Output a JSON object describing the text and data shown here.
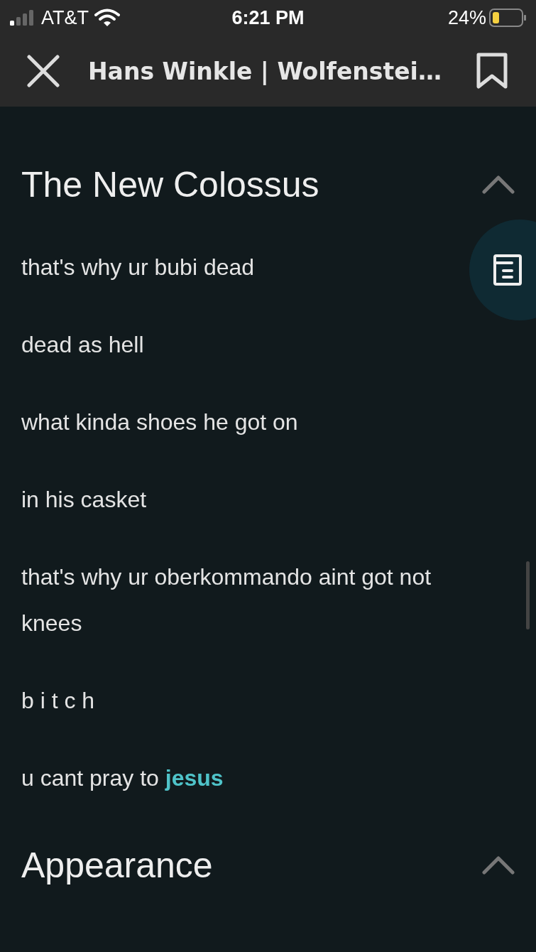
{
  "status_bar": {
    "carrier": "AT&T",
    "time": "6:21 PM",
    "battery": "24%"
  },
  "header": {
    "title": "Hans Winkle | Wolfenstei…"
  },
  "sections": [
    {
      "heading": "The New Colossus",
      "expanded": true,
      "paragraphs": [
        [
          {
            "text": "that's why ur bubi dead"
          }
        ],
        [
          {
            "text": "dead as hell"
          }
        ],
        [
          {
            "text": "what kinda shoes he got on"
          }
        ],
        [
          {
            "text": "in his casket"
          }
        ],
        [
          {
            "text": "that's why ur oberkommando aint got not knees"
          }
        ],
        [
          {
            "text": "b i t c h"
          }
        ],
        [
          {
            "text": "u cant pray to "
          },
          {
            "text": "jesus",
            "kind": "link"
          }
        ]
      ]
    },
    {
      "heading": "Appearance",
      "expanded": true
    }
  ]
}
